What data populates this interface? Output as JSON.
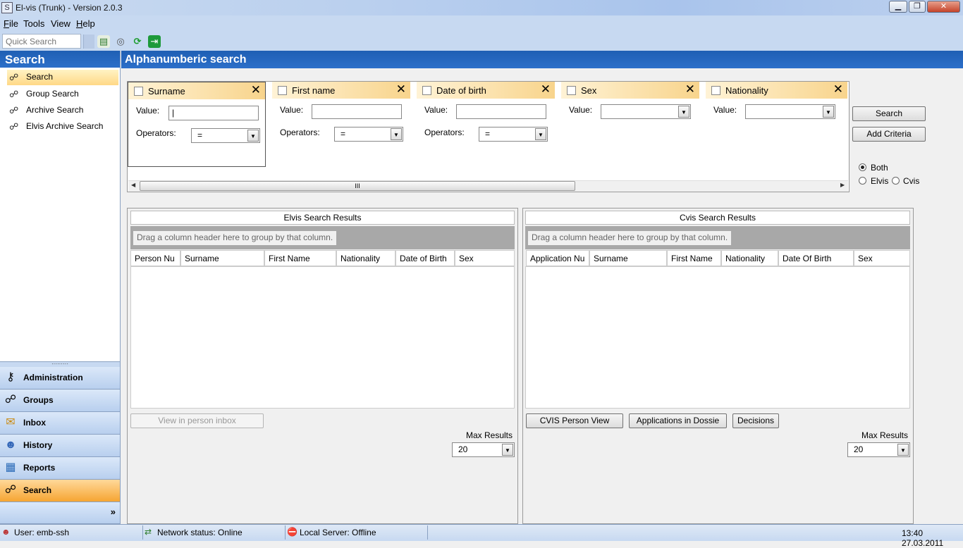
{
  "window": {
    "title": "El-vis (Trunk) - Version 2.0.3",
    "minimize": "▁",
    "maximize": "❐",
    "close": "✕"
  },
  "menu": {
    "file": {
      "acc": "F",
      "rest": "ile"
    },
    "tools": {
      "acc": "",
      "rest": "Tools"
    },
    "view": {
      "acc": "",
      "rest": "View"
    },
    "help": {
      "acc": "H",
      "rest": "elp"
    }
  },
  "toolbar": {
    "quick_search_placeholder": "Quick Search"
  },
  "left": {
    "header": "Search",
    "items": [
      {
        "label": "Search",
        "icon": "binoculars-icon"
      },
      {
        "label": "Group Search",
        "icon": "binoculars-icon"
      },
      {
        "label": "Archive Search",
        "icon": "binoculars-icon"
      },
      {
        "label": "Elvis Archive Search",
        "icon": "binoculars-icon"
      }
    ],
    "buttons": [
      {
        "label": "Administration",
        "icon": "keys-icon"
      },
      {
        "label": "Groups",
        "icon": "binoculars-icon"
      },
      {
        "label": "Inbox",
        "icon": "envelope-icon"
      },
      {
        "label": "History",
        "icon": "people-icon"
      },
      {
        "label": "Reports",
        "icon": "report-icon"
      },
      {
        "label": "Search",
        "icon": "binoculars-icon"
      }
    ],
    "expand": "»"
  },
  "main": {
    "header": "Alphanumberic search",
    "criteria": [
      {
        "title": "Surname",
        "value_label": "Value:",
        "operators_label": "Operators:",
        "operator": "="
      },
      {
        "title": "First name",
        "value_label": "Value:",
        "operators_label": "Operators:",
        "operator": "="
      },
      {
        "title": "Date of birth",
        "value_label": "Value:",
        "operators_label": "Operators:",
        "operator": "="
      },
      {
        "title": "Sex",
        "value_label": "Value:"
      },
      {
        "title": "Nationality",
        "value_label": "Value:"
      }
    ],
    "scroll_grip": "III",
    "search_button": "Search",
    "add_criteria_button": "Add Criteria",
    "scope": {
      "both": "Both",
      "elvis": "Elvis",
      "cvis": "Cvis",
      "selected": "Both"
    }
  },
  "elvis_results": {
    "title": "Elvis Search Results",
    "group_hint": "Drag a column header here to group by that column.",
    "columns": [
      "Person Nu",
      "Surname",
      "First Name",
      "Nationality",
      "Date of Birth",
      "Sex"
    ],
    "view_inbox_button": "View in person inbox",
    "max_results_label": "Max Results",
    "max_results": "20"
  },
  "cvis_results": {
    "title": "Cvis Search Results",
    "group_hint": "Drag a column header here to group by that column.",
    "columns": [
      "Application Nu",
      "Surname",
      "First Name",
      "Nationality",
      "Date Of Birth",
      "Sex"
    ],
    "buttons": [
      "CVIS Person View",
      "Applications in Dossie",
      "Decisions"
    ],
    "max_results_label": "Max Results",
    "max_results": "20"
  },
  "status": {
    "user": "User: emb-ssh",
    "network": "Network status: Online",
    "server": "Local Server:  Offline",
    "datetime": "13:40 27.03.2011"
  }
}
